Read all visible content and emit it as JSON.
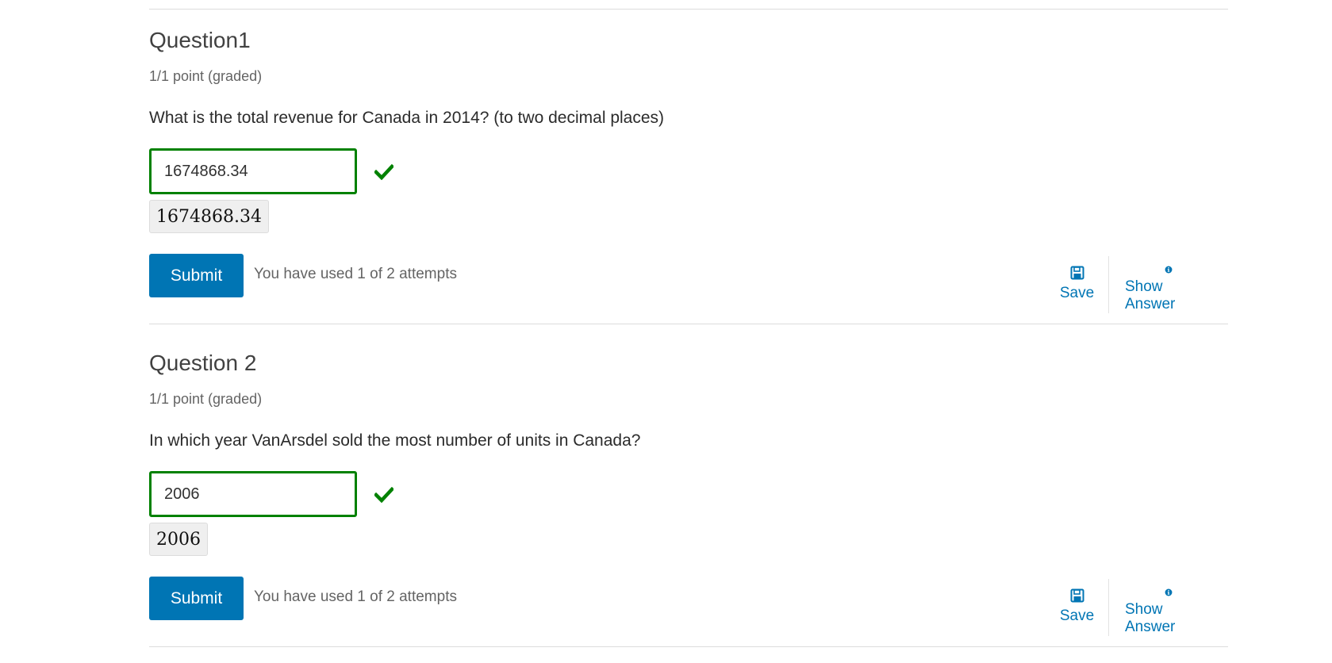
{
  "questions": [
    {
      "title": "Question1",
      "points": "1/1 point (graded)",
      "prompt": "What is the total revenue for Canada in 2014? (to two decimal places)",
      "answer_value": "1674868.34",
      "rendered_preview": "1674868.34",
      "status_icon": "check-icon",
      "submit_label": "Submit",
      "attempts_text": "You have used 1 of 2 attempts",
      "save_label": "Save",
      "show_answer_label": "Show Answer"
    },
    {
      "title": "Question 2",
      "points": "1/1 point (graded)",
      "prompt": "In which year VanArsdel sold the most number of units in Canada?",
      "answer_value": "2006",
      "rendered_preview": "2006",
      "status_icon": "check-icon",
      "submit_label": "Submit",
      "attempts_text": "You have used 1 of 2 attempts",
      "save_label": "Save",
      "show_answer_label": "Show Answer"
    }
  ],
  "colors": {
    "accent": "#0075b4",
    "correct": "#008100",
    "text": "#313131",
    "muted": "#646464",
    "divider": "#dcdcdc"
  }
}
